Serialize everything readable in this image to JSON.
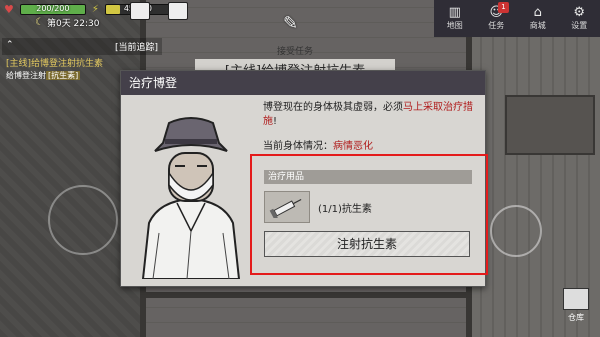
{
  "hud": {
    "health": {
      "text": "200/200",
      "level": 1.0,
      "color": "#5fae4a"
    },
    "energy": {
      "text": "45/200",
      "level": 0.225,
      "color": "#d2c742"
    },
    "day_label": "第0天 22:30"
  },
  "top_menu": {
    "items": [
      {
        "label": "地图",
        "icon": "map-icon",
        "glyph": "▥"
      },
      {
        "label": "任务",
        "icon": "people-icon",
        "glyph": "☺",
        "badge": "1"
      },
      {
        "label": "商城",
        "icon": "shop-icon",
        "glyph": "⌂"
      },
      {
        "label": "设置",
        "icon": "gear-icon",
        "glyph": "⚙"
      }
    ]
  },
  "tracker": {
    "head_label": "[当前追踪]",
    "quest_line": "[主线]给博登注射抗生素",
    "sub_prefix": "给博登注射",
    "sub_highlight": "[抗生素]"
  },
  "banner": {
    "top": "接受任务",
    "title": "[主线]给博登注射抗生素"
  },
  "modal": {
    "title": "治疗博登",
    "desc_plain": "博登现在的身体极其虚弱，必须",
    "desc_red": "马上采取治疗措施",
    "desc_end": "!",
    "cond_label": "当前身体情况：",
    "cond_value": "病情恶化",
    "supplies_title": "治疗用品",
    "item_label": "(1/1)抗生素",
    "inject_label": "注射抗生素"
  },
  "storage_label": "仓库",
  "colors": {
    "accent_red": "#e41b1b",
    "header_dark": "#44404a"
  }
}
